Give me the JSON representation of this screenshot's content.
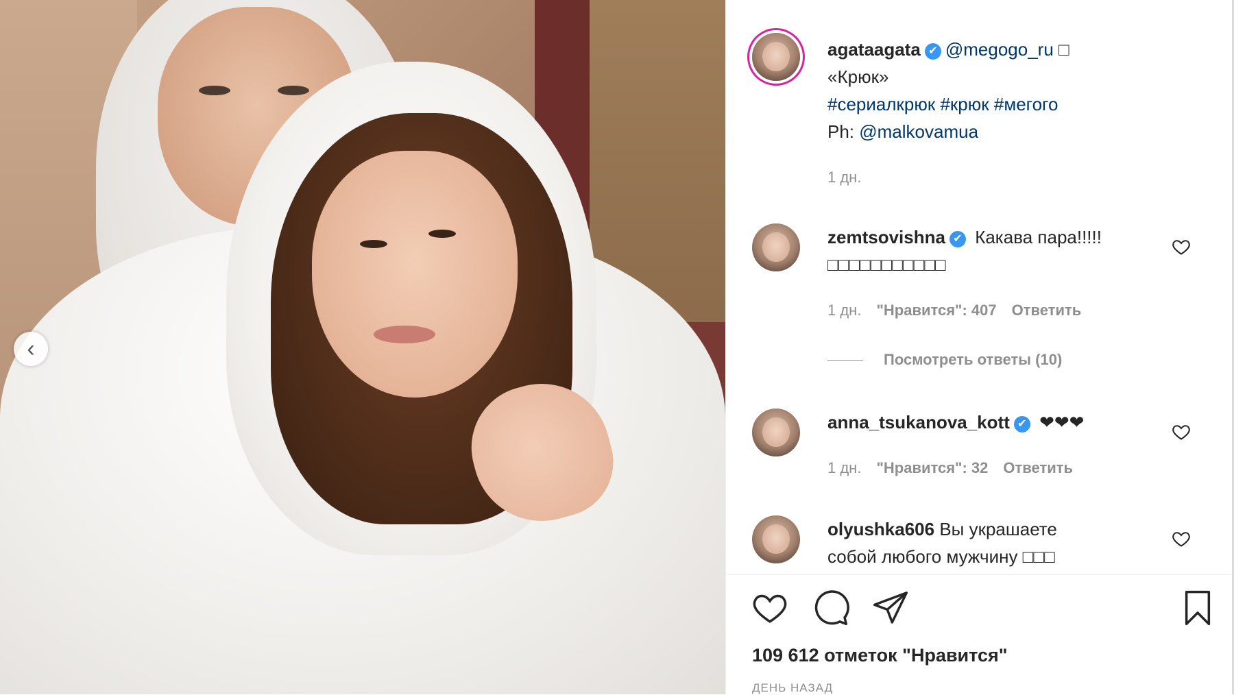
{
  "post": {
    "author": "agataagata",
    "mention": "@megogo_ru",
    "caption_tail": "□",
    "caption_line2": "«Крюк»",
    "hashtags": "#сериалкрюк #крюк #мегого",
    "ph_label": "Ph: ",
    "ph_mention": "@malkovamua",
    "time": "1 дн."
  },
  "comments": [
    {
      "user": "zemtsovishna",
      "verified": true,
      "text": "Какава пара!!!!!",
      "text2": "□□□□□□□□□□□",
      "time": "1 дн.",
      "likes": "\"Нравится\": 407",
      "reply": "Ответить",
      "view_replies": "Посмотреть ответы (10)"
    },
    {
      "user": "anna_tsukanova_kott",
      "verified": true,
      "text": "❤❤❤",
      "time": "1 дн.",
      "likes": "\"Нравится\": 32",
      "reply": "Ответить"
    },
    {
      "user": "olyushka606",
      "verified": false,
      "text": "Вы украшаете",
      "text2": "собой любого мужчину □□□"
    }
  ],
  "footer": {
    "likes_count": "109 612 отметок \"Нравится\"",
    "ago": "День назад"
  },
  "icons": {
    "verified": "✔",
    "prev": "‹"
  }
}
